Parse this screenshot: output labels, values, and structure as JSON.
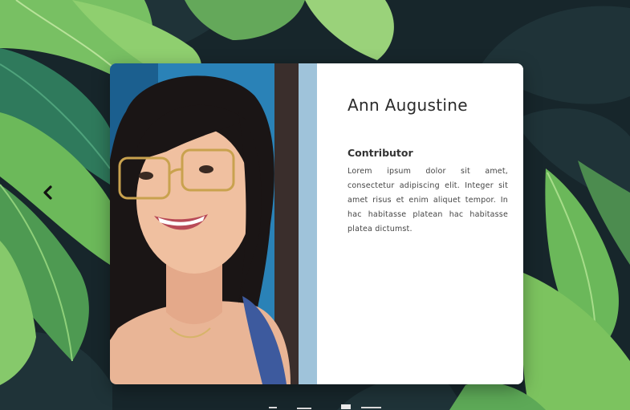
{
  "profile": {
    "name": "Ann Augustine",
    "role": "Contributor",
    "bio": "Lorem ipsum dolor sit amet, consectetur adipiscing elit. Integer sit amet risus et enim aliquet tempor. In hac habitasse platean hac habitasse platea dictumst."
  },
  "slider": {
    "prev_icon": "chevron-left-icon"
  },
  "colors": {
    "background": "#17262b",
    "leaf_light": "#7fc45a",
    "leaf_dark": "#2f7d5a",
    "card": "#ffffff",
    "text": "#2b2b2b"
  }
}
